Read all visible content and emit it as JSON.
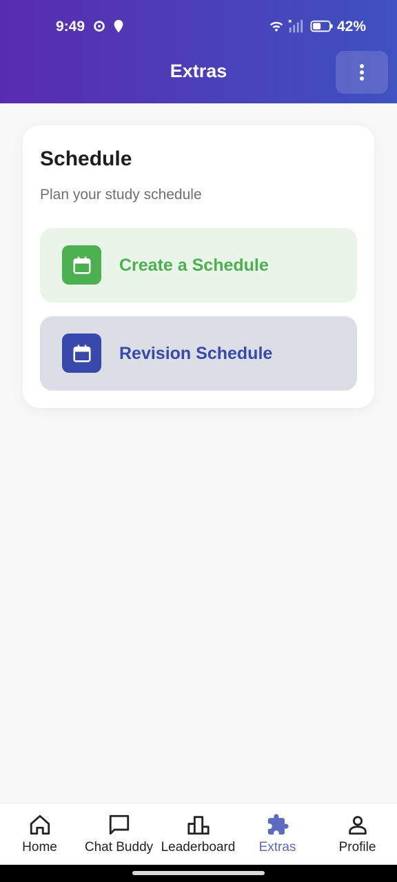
{
  "status_bar": {
    "time": "9:49",
    "battery": "42%"
  },
  "header": {
    "title": "Extras"
  },
  "card": {
    "title": "Schedule",
    "subtitle": "Plan your study schedule",
    "options": [
      {
        "label": "Create a Schedule",
        "icon": "calendar-icon",
        "color": "#4caf50"
      },
      {
        "label": "Revision Schedule",
        "icon": "calendar-icon",
        "color": "#3949ab"
      }
    ]
  },
  "bottom_nav": {
    "items": [
      {
        "label": "Home",
        "icon": "home-icon"
      },
      {
        "label": "Chat Buddy",
        "icon": "chat-icon"
      },
      {
        "label": "Leaderboard",
        "icon": "leaderboard-icon"
      },
      {
        "label": "Extras",
        "icon": "puzzle-icon",
        "active": true
      },
      {
        "label": "Profile",
        "icon": "profile-icon"
      }
    ]
  },
  "colors": {
    "header_gradient_start": "#5a2bb0",
    "header_gradient_end": "#3f52bf",
    "active_nav": "#5c6bc0"
  }
}
